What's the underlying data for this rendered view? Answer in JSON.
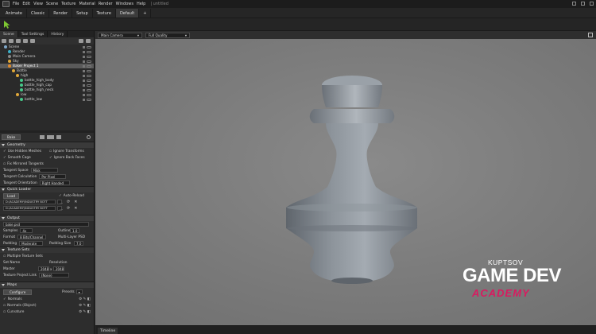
{
  "menubar": {
    "items": [
      "File",
      "Edit",
      "View",
      "Scene",
      "Texture",
      "Material",
      "Render",
      "Windows",
      "Help"
    ],
    "project_title": "| untitled"
  },
  "modes": [
    "Animate",
    "Classic",
    "Render",
    "Setup",
    "Texture",
    "Default",
    "+"
  ],
  "left_tabs": [
    "Scene",
    "Tool Settings",
    "History"
  ],
  "tree": [
    {
      "label": "Scene",
      "indent": 1,
      "color": "#7fa7c9",
      "selected": false
    },
    {
      "label": "Render",
      "indent": 2,
      "color": "#3bb0c9",
      "selected": false
    },
    {
      "label": "Main Camera",
      "indent": 2,
      "color": "#8a8a8a",
      "selected": false
    },
    {
      "label": "Sky",
      "indent": 2,
      "color": "#e0a83a",
      "selected": false
    },
    {
      "label": "Baker Project 1",
      "indent": 2,
      "color": "#e08a2a",
      "selected": true
    },
    {
      "label": "Bottle",
      "indent": 3,
      "color": "#e0a83a",
      "selected": false
    },
    {
      "label": "high",
      "indent": 4,
      "color": "#e0a83a",
      "selected": false
    },
    {
      "label": "bottle_high_body",
      "indent": 5,
      "color": "#47c98a",
      "selected": false
    },
    {
      "label": "bottle_high_cap",
      "indent": 5,
      "color": "#47c98a",
      "selected": false
    },
    {
      "label": "bottle_high_neck",
      "indent": 5,
      "color": "#47c98a",
      "selected": false
    },
    {
      "label": "low",
      "indent": 4,
      "color": "#e0a83a",
      "selected": false
    },
    {
      "label": "bottle_low",
      "indent": 5,
      "color": "#47c98a",
      "selected": false
    }
  ],
  "bake_button": "Bake",
  "geometry": {
    "header": "Geometry",
    "use_hidden_meshes": "Use Hidden Meshes",
    "ignore_transforms": "Ignore Transforms",
    "smooth_cage": "Smooth Cage",
    "ignore_back_faces": "Ignore Back Faces",
    "fix_mirrored": "Fix Mirrored Tangents",
    "tangent_space_label": "Tangent Space",
    "tangent_space_value": "Mikk",
    "tangent_calc_label": "Tangent Calculation",
    "tangent_calc_value": "Per Pixel",
    "tangent_orient_label": "Tangent Orientation",
    "tangent_orient_value": "Right Handed"
  },
  "quick_loader": {
    "header": "Quick Loader",
    "load_button": "Load",
    "auto_reload": "Auto-Reload",
    "path1": "D:/ACADEMY/INDUSTRY BOTT",
    "path2": "D:/ACADEMY/INDUSTRY BOTT"
  },
  "output": {
    "header": "Output",
    "filename": "bake.psd",
    "samples_label": "Samples",
    "samples_value": "4x",
    "outlines_label": "Outlines",
    "outlines_value": "1.0",
    "format_label": "Format",
    "format_value": "8 Bits/Channel",
    "multilayer": "Multi-Layer PSD",
    "padding_label": "Padding",
    "padding_value": "Moderate",
    "padding_size_label": "Padding Size",
    "padding_size_value": "7.0"
  },
  "texture_sets": {
    "header": "Texture Sets",
    "multiple": "Multiple Texture Sets",
    "set_name": "Set Name",
    "resolution": "Resolution",
    "master": "Master",
    "res_w": "2048",
    "res_h": "2048",
    "project_link_label": "Texture Project Link",
    "project_link_value": "(None)"
  },
  "maps": {
    "header": "Maps",
    "configure": "Configure",
    "presets": "Presets",
    "normals": "Normals",
    "normals_object": "Normals (Object)",
    "curvature": "Curvature"
  },
  "viewport": {
    "camera": "Main Camera",
    "quality": "Full Quality"
  },
  "timeline_tab": "Timeline",
  "watermark": {
    "line1": "KUPTSOV",
    "line2": "GAME DEV",
    "line3": "ACADEMY"
  },
  "colors": {
    "accent_green": "#7ec832",
    "selection": "#5a5a5a",
    "academy_pink": "#d81b60"
  }
}
